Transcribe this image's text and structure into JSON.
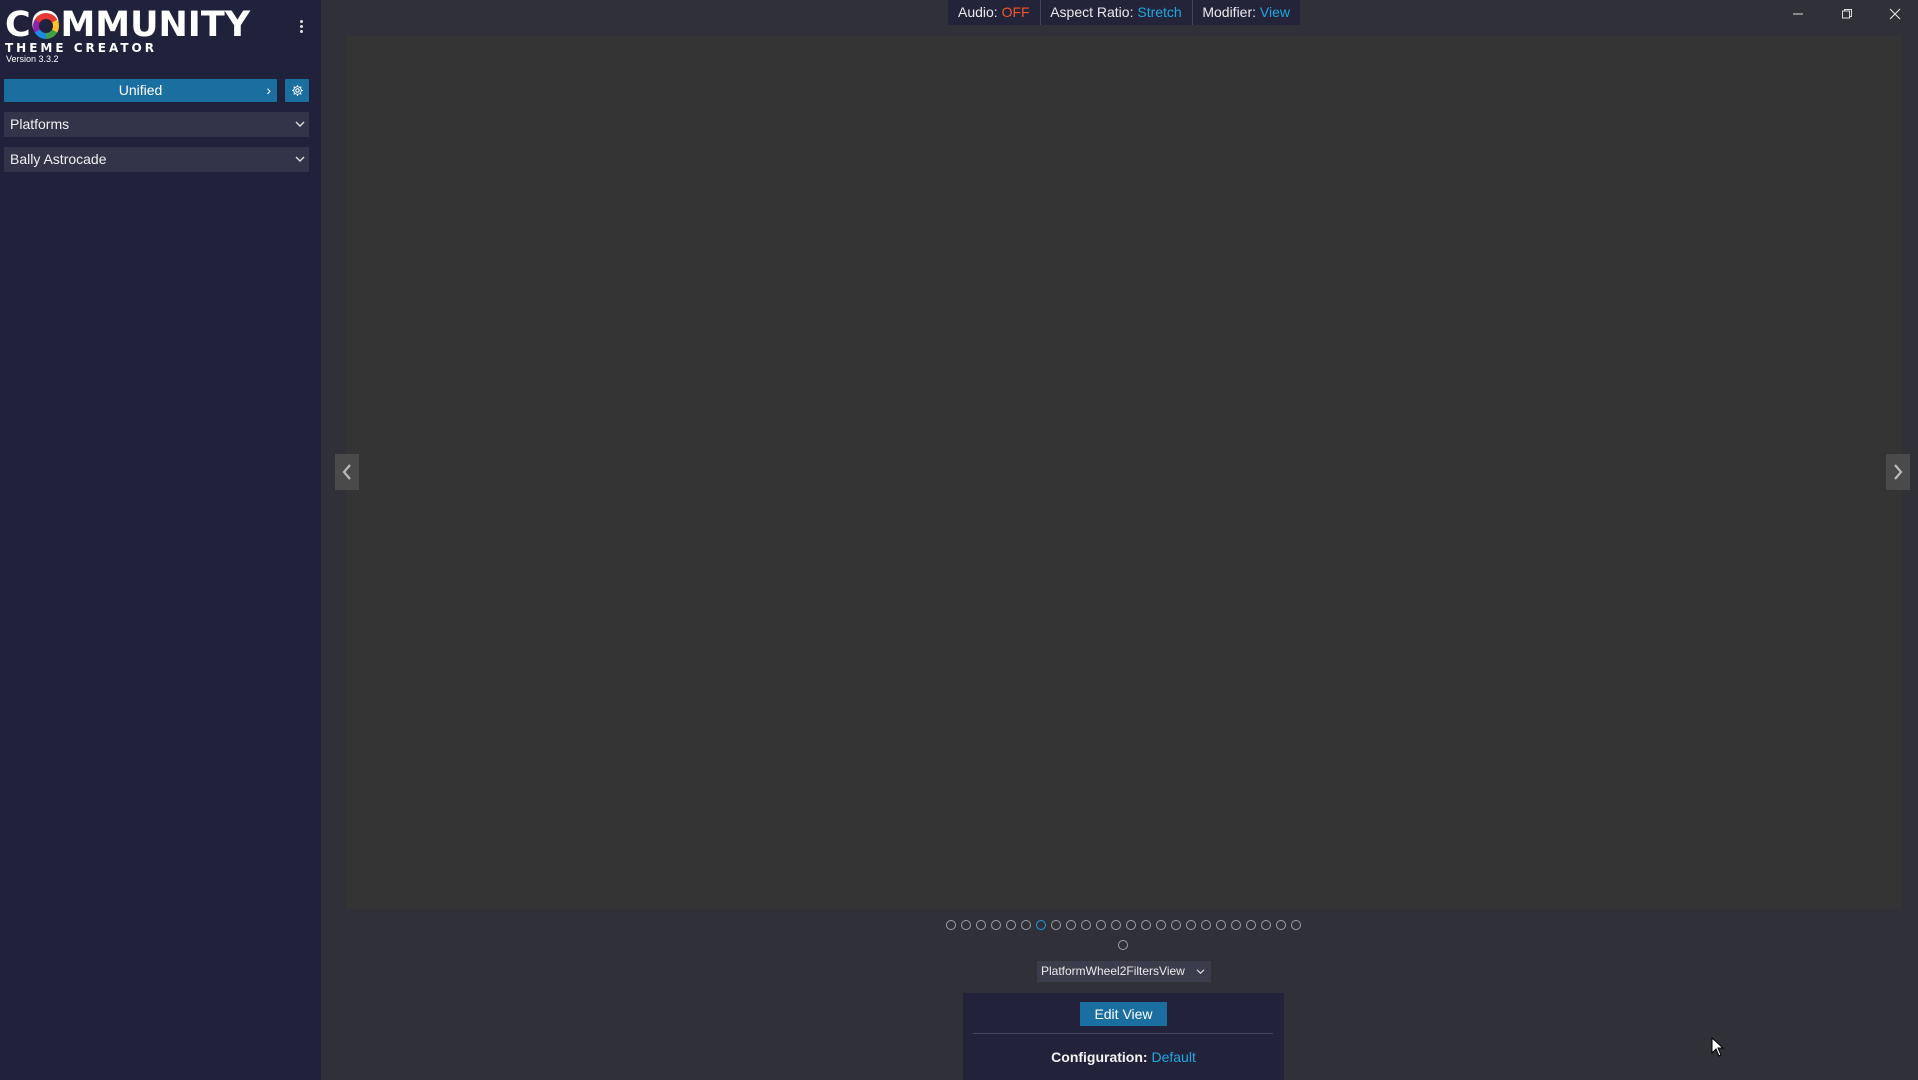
{
  "app": {
    "logo_line1": "COMMUNITY",
    "logo_line2": "THEME CREATOR",
    "version": "Version 3.3.2",
    "menu_icon": "kebab-icon"
  },
  "sidebar": {
    "theme_button": "Unified",
    "settings_icon": "gear-icon",
    "category_select": "Platforms",
    "platform_select": "Bally Astrocade"
  },
  "status": {
    "audio_key": "Audio:",
    "audio_val": "OFF",
    "aspect_key": "Aspect Ratio:",
    "aspect_val": "Stretch",
    "modifier_key": "Modifier:",
    "modifier_val": "View"
  },
  "colors": {
    "accent": "#1b6fa0",
    "link": "#23a7e0",
    "off": "#f2552c"
  },
  "pagination": {
    "total": 24,
    "active_index": 6,
    "second_row": 1
  },
  "view": {
    "selected": "PlatformWheel2FiltersView",
    "edit_button": "Edit View",
    "config_key": "Configuration:",
    "config_val": "Default"
  }
}
